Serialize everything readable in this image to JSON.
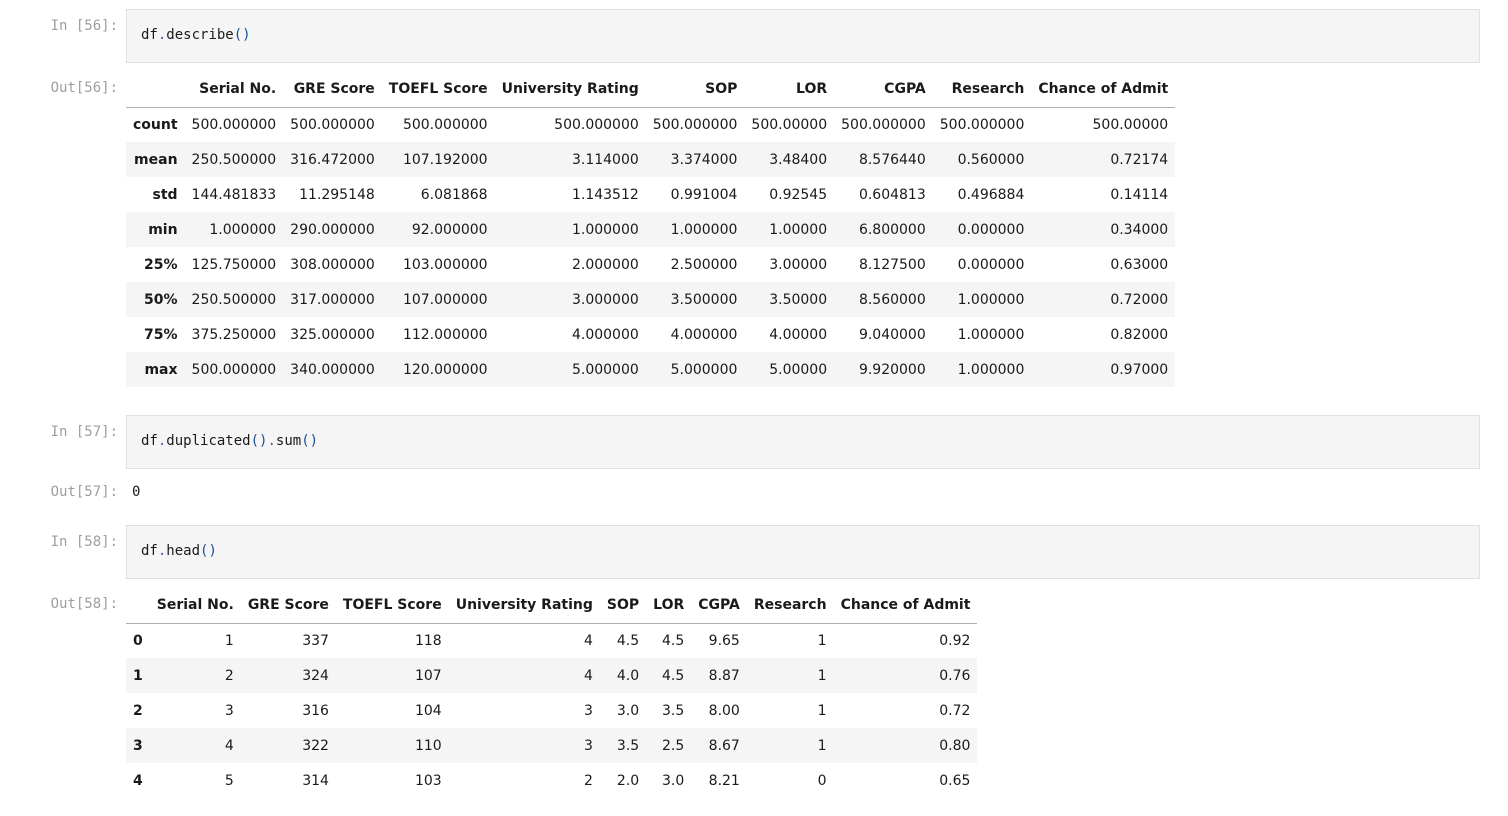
{
  "cells": {
    "c56": {
      "in_prompt": "In [56]:",
      "code_obj": "df",
      "code_dot": ".",
      "code_fn": "describe",
      "code_args": "()",
      "out_prompt": "Out[56]:"
    },
    "c57": {
      "in_prompt": "In [57]:",
      "code_obj": "df",
      "code_dot1": ".",
      "code_fn1": "duplicated",
      "code_args1": "()",
      "code_dot2": ".",
      "code_fn2": "sum",
      "code_args2": "()",
      "out_prompt": "Out[57]:",
      "output_value": "0"
    },
    "c58": {
      "in_prompt": "In [58]:",
      "code_obj": "df",
      "code_dot": ".",
      "code_fn": "head",
      "code_args": "()",
      "out_prompt": "Out[58]:"
    }
  },
  "describe_table": {
    "columns": [
      "Serial No.",
      "GRE Score",
      "TOEFL Score",
      "University Rating",
      "SOP",
      "LOR",
      "CGPA",
      "Research",
      "Chance of Admit"
    ],
    "rows": [
      {
        "index": "count",
        "values": [
          "500.000000",
          "500.000000",
          "500.000000",
          "500.000000",
          "500.000000",
          "500.00000",
          "500.000000",
          "500.000000",
          "500.00000"
        ]
      },
      {
        "index": "mean",
        "values": [
          "250.500000",
          "316.472000",
          "107.192000",
          "3.114000",
          "3.374000",
          "3.48400",
          "8.576440",
          "0.560000",
          "0.72174"
        ]
      },
      {
        "index": "std",
        "values": [
          "144.481833",
          "11.295148",
          "6.081868",
          "1.143512",
          "0.991004",
          "0.92545",
          "0.604813",
          "0.496884",
          "0.14114"
        ]
      },
      {
        "index": "min",
        "values": [
          "1.000000",
          "290.000000",
          "92.000000",
          "1.000000",
          "1.000000",
          "1.00000",
          "6.800000",
          "0.000000",
          "0.34000"
        ]
      },
      {
        "index": "25%",
        "values": [
          "125.750000",
          "308.000000",
          "103.000000",
          "2.000000",
          "2.500000",
          "3.00000",
          "8.127500",
          "0.000000",
          "0.63000"
        ]
      },
      {
        "index": "50%",
        "values": [
          "250.500000",
          "317.000000",
          "107.000000",
          "3.000000",
          "3.500000",
          "3.50000",
          "8.560000",
          "1.000000",
          "0.72000"
        ]
      },
      {
        "index": "75%",
        "values": [
          "375.250000",
          "325.000000",
          "112.000000",
          "4.000000",
          "4.000000",
          "4.00000",
          "9.040000",
          "1.000000",
          "0.82000"
        ]
      },
      {
        "index": "max",
        "values": [
          "500.000000",
          "340.000000",
          "120.000000",
          "5.000000",
          "5.000000",
          "5.00000",
          "9.920000",
          "1.000000",
          "0.97000"
        ]
      }
    ]
  },
  "head_table": {
    "columns": [
      "Serial No.",
      "GRE Score",
      "TOEFL Score",
      "University Rating",
      "SOP",
      "LOR",
      "CGPA",
      "Research",
      "Chance of Admit"
    ],
    "rows": [
      {
        "index": "0",
        "values": [
          "1",
          "337",
          "118",
          "4",
          "4.5",
          "4.5",
          "9.65",
          "1",
          "0.92"
        ]
      },
      {
        "index": "1",
        "values": [
          "2",
          "324",
          "107",
          "4",
          "4.0",
          "4.5",
          "8.87",
          "1",
          "0.76"
        ]
      },
      {
        "index": "2",
        "values": [
          "3",
          "316",
          "104",
          "3",
          "3.0",
          "3.5",
          "8.00",
          "1",
          "0.72"
        ]
      },
      {
        "index": "3",
        "values": [
          "4",
          "322",
          "110",
          "3",
          "3.5",
          "2.5",
          "8.67",
          "1",
          "0.80"
        ]
      },
      {
        "index": "4",
        "values": [
          "5",
          "314",
          "103",
          "2",
          "2.0",
          "3.0",
          "8.21",
          "0",
          "0.65"
        ]
      }
    ]
  }
}
